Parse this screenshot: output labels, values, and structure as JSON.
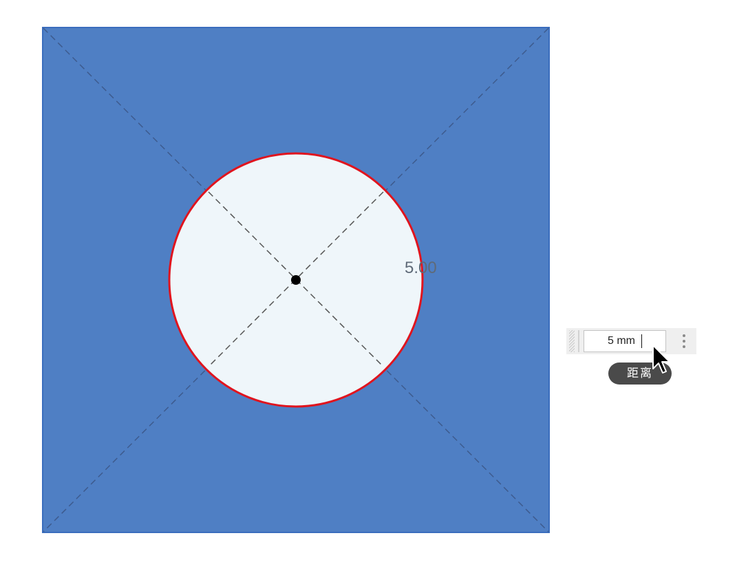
{
  "sketch": {
    "dimension_label": "5.00",
    "colors": {
      "profile_fill": "#4f7fc4",
      "profile_border": "#3a6dbd",
      "hole_fill": "#eff6fa",
      "hole_outline": "#e0141e",
      "construction_line": "#3b5585",
      "inner_construction_line": "#555555",
      "center_point": "#000000"
    }
  },
  "distance_widget": {
    "input_value": "5 mm",
    "menu_icon": "more-vertical-icon",
    "grip_icon": "drag-handle-icon"
  },
  "tooltip": {
    "label": "距离"
  },
  "cursor": {
    "icon": "arrow-pointer-icon"
  }
}
